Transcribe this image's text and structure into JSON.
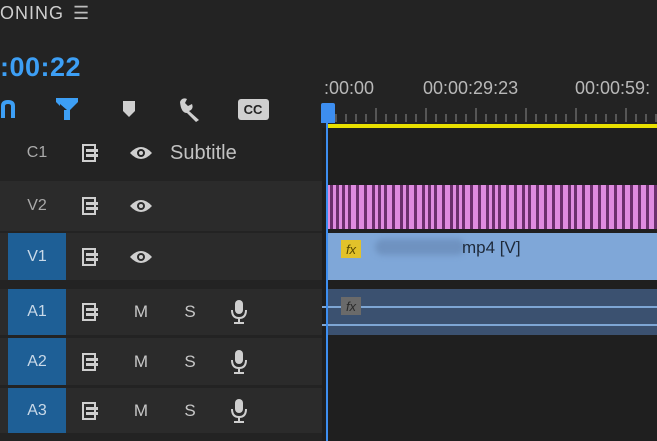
{
  "header": {
    "title": "ONING",
    "menu_icon": "hamburger-menu-icon"
  },
  "timecode": ":00:22",
  "toolbar": {
    "icons": [
      "ripple-icon",
      "snap-icon",
      "marker-icon",
      "wrench-icon",
      "captions-icon"
    ],
    "captions_label": "CC"
  },
  "ruler": {
    "labels": [
      ":00:00",
      "00:00:29:23",
      "00:00:59:"
    ]
  },
  "tracks": [
    {
      "id": "C1",
      "type": "caption",
      "label": "Subtitle",
      "active": false
    },
    {
      "id": "V2",
      "type": "video",
      "label": "",
      "active": false
    },
    {
      "id": "V1",
      "type": "video",
      "label": "",
      "active": true
    },
    {
      "id": "A1",
      "type": "audio",
      "mute": "M",
      "solo": "S",
      "active": true
    },
    {
      "id": "A2",
      "type": "audio",
      "mute": "M",
      "solo": "S",
      "active": true
    },
    {
      "id": "A3",
      "type": "audio",
      "mute": "M",
      "solo": "S",
      "active": true
    }
  ],
  "clips": {
    "video_v1": {
      "name_suffix": "mp4 [V]",
      "fx": "fx"
    },
    "audio_a1": {
      "fx": "fx"
    }
  },
  "colors": {
    "accent": "#3d9ff5",
    "playhead": "#3d8ef0",
    "work_area": "#e8e000",
    "subtitle_clip": "#df8be0",
    "video_clip": "#7fa7d8",
    "audio_clip": "#3b5170",
    "active_track": "#1e5f96"
  }
}
